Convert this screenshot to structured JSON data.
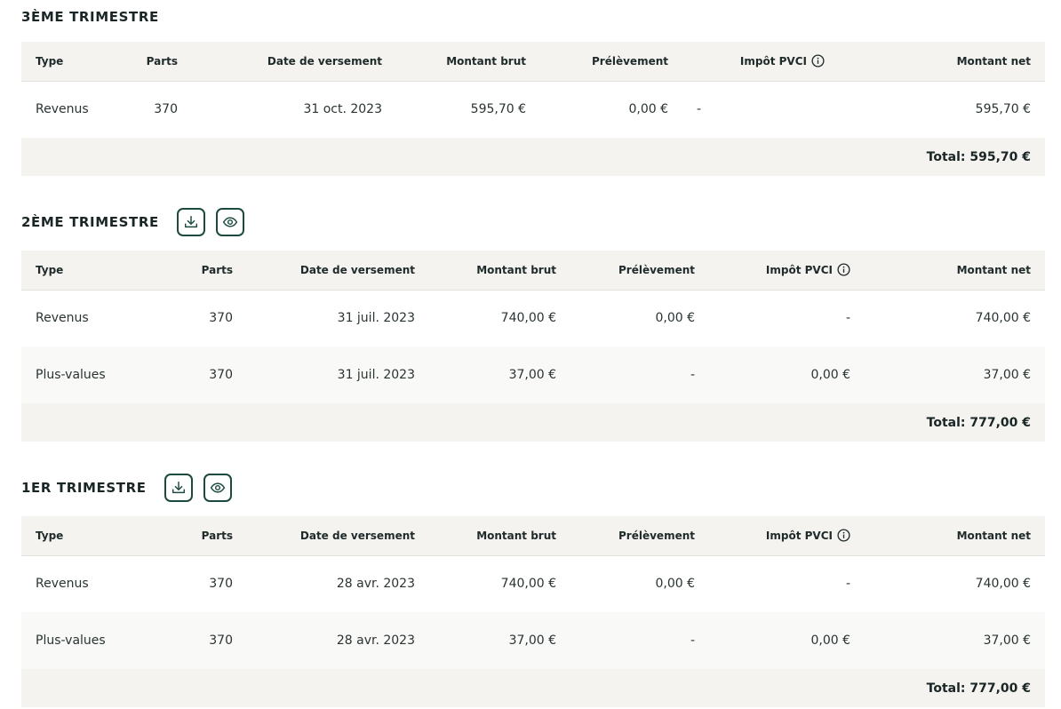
{
  "headers": {
    "type": "Type",
    "parts": "Parts",
    "date": "Date de versement",
    "brut": "Montant brut",
    "prelevement": "Prélèvement",
    "impot": "Impôt PVCI",
    "net": "Montant net"
  },
  "sections": [
    {
      "title": "3ÈME TRIMESTRE",
      "rows": [
        {
          "type": "Revenus",
          "parts": "370",
          "date": "31 oct. 2023",
          "brut": "595,70 €",
          "prelevement": "0,00 €",
          "impot": "-",
          "net": "595,70 €"
        }
      ],
      "total": "Total: 595,70 €"
    },
    {
      "title": "2ÈME TRIMESTRE",
      "rows": [
        {
          "type": "Revenus",
          "parts": "370",
          "date": "31 juil. 2023",
          "brut": "740,00 €",
          "prelevement": "0,00 €",
          "impot": "-",
          "net": "740,00 €"
        },
        {
          "type": "Plus-values",
          "parts": "370",
          "date": "31 juil. 2023",
          "brut": "37,00 €",
          "prelevement": "-",
          "impot": "0,00 €",
          "net": "37,00 €"
        }
      ],
      "total": "Total: 777,00 €"
    },
    {
      "title": "1ER TRIMESTRE",
      "rows": [
        {
          "type": "Revenus",
          "parts": "370",
          "date": "28 avr. 2023",
          "brut": "740,00 €",
          "prelevement": "0,00 €",
          "impot": "-",
          "net": "740,00 €"
        },
        {
          "type": "Plus-values",
          "parts": "370",
          "date": "28 avr. 2023",
          "brut": "37,00 €",
          "prelevement": "-",
          "impot": "0,00 €",
          "net": "37,00 €"
        }
      ],
      "total": "Total: 777,00 €"
    }
  ],
  "icons": {
    "download": "download-icon",
    "preview": "eye-icon",
    "info": "info-icon"
  },
  "colors": {
    "accent": "#1c4a40",
    "header_bg": "#f4f3ef",
    "alt_row_bg": "#f9f9f8"
  }
}
